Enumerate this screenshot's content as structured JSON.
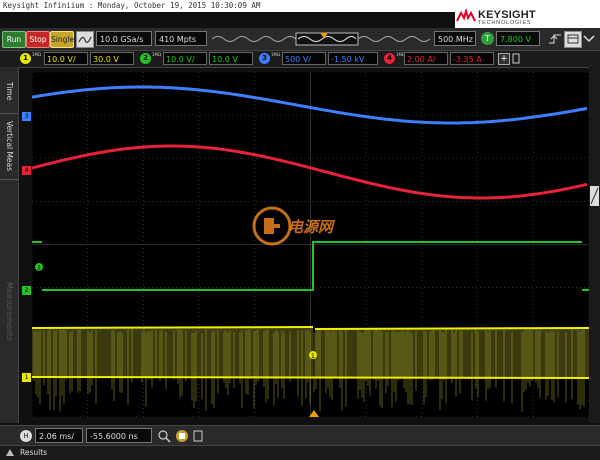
{
  "window": {
    "title": "Keysight Infiniium : Monday, October 19, 2015 10:30:09 AM"
  },
  "brand": {
    "name": "KEYSIGHT",
    "sub": "TECHNOLOGIES"
  },
  "toolbar": {
    "run_label": "Run",
    "stop_label": "Stop",
    "single_label": "Single",
    "sample_rate": "10.0 GSa/s",
    "memory_depth": "410 Mpts",
    "bandwidth": "500 MHz",
    "trigger_badge": "T",
    "trigger_level": "7.800 V"
  },
  "channels": [
    {
      "num": "1",
      "imp": "1MΩ",
      "scale": "10.0 V/",
      "offset": "30.0 V",
      "color": "#e8e800"
    },
    {
      "num": "2",
      "imp": "1MΩ",
      "scale": "10.0 V/",
      "offset": "10.0 V",
      "color": "#27c227"
    },
    {
      "num": "3",
      "imp": "1MΩ",
      "scale": "500 V/",
      "offset": "-1.50 kV",
      "color": "#3f7fff"
    },
    {
      "num": "4",
      "imp": "1MΩ",
      "scale": "2.00 A/",
      "offset": "-3.35 A",
      "color": "#e8223a"
    }
  ],
  "sidebar": {
    "tabs": [
      "Time Meas",
      "Vertical Meas",
      "Measurements"
    ]
  },
  "timebase": {
    "badge": "H",
    "scale": "2.06 ms/",
    "position": "-55.6000 ns"
  },
  "results": {
    "label": "Results"
  },
  "watermark": {
    "text": "电源网"
  },
  "markers": {
    "ch1": "1",
    "ch2": "2",
    "ch3": "3",
    "ch4": "4",
    "ch3_badge": "3",
    "ch1_badge": "1"
  }
}
